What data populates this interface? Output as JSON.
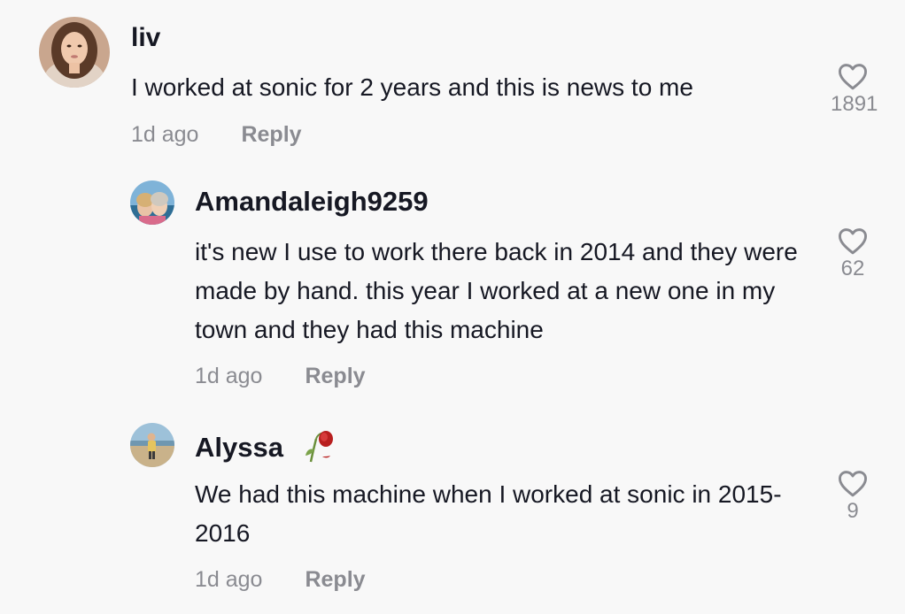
{
  "comments": [
    {
      "author": "liv",
      "text": "I worked at sonic for 2 years and this is news to me",
      "time": "1d ago",
      "reply_label": "Reply",
      "likes": "1891"
    },
    {
      "author": "Amandaleigh9259",
      "text": "it's new I use to work there back in 2014 and they were made by hand. this year I worked at a new one in my town and they had this machine",
      "time": "1d ago",
      "reply_label": "Reply",
      "likes": "62"
    },
    {
      "author": "Alyssa",
      "author_emoji": "wilted-rose-icon",
      "text": "We had this machine when I worked at sonic in 2015-2016",
      "time": "1d ago",
      "reply_label": "Reply",
      "likes": "9"
    }
  ],
  "colors": {
    "background": "#f8f8f8",
    "text": "#161823",
    "muted": "#8a8b91"
  }
}
